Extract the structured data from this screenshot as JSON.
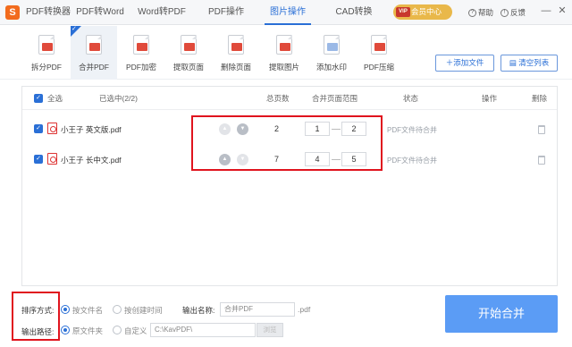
{
  "nav": {
    "logo": "S",
    "tabs": [
      "PDF转换器",
      "PDF转Word",
      "Word转PDF",
      "PDF操作",
      "图片操作",
      "CAD转换"
    ],
    "active_tab": "图片操作",
    "vip_badge": "VIP",
    "vip_label": "会员中心",
    "help_label": "帮助",
    "feedback_label": "反馈",
    "window_controls": [
      "—",
      "✕"
    ]
  },
  "toolbar": {
    "tools": [
      "拆分PDF",
      "合并PDF",
      "PDF加密",
      "提取页面",
      "删除页面",
      "提取图片",
      "添加水印",
      "PDF压缩"
    ],
    "active_tool": "合并PDF",
    "add_file": "添加文件",
    "clear_list": "清空列表"
  },
  "table": {
    "headers": {
      "select_all": "全选",
      "selected": "已选中(2/2)",
      "total_pages": "总页数",
      "merge_range": "合并页面范围",
      "status": "状态",
      "action": "操作",
      "delete": "删除"
    },
    "rows": [
      {
        "name": "小王子 英文版.pdf",
        "pages": "2",
        "from": "1",
        "to": "2",
        "status": "PDF文件待合并"
      },
      {
        "name": "小王子 长中文.pdf",
        "pages": "7",
        "from": "4",
        "to": "5",
        "status": "PDF文件待合并"
      }
    ]
  },
  "bottom": {
    "sort_label": "排序方式:",
    "sort_by_name": "按文件名",
    "sort_by_time": "按创建时间",
    "output_name_label": "输出名称:",
    "output_name_value": "合并PDF",
    "output_ext": ".pdf",
    "output_path_label": "输出路径:",
    "path_original": "原文件夹",
    "path_custom": "自定义",
    "path_value": "C:\\KavPDF\\",
    "browse": "浏览",
    "start": "开始合并"
  },
  "colors": {
    "accent": "#2a6fd6",
    "highlight": "#e0141e",
    "start_button": "#5b9cf5"
  }
}
